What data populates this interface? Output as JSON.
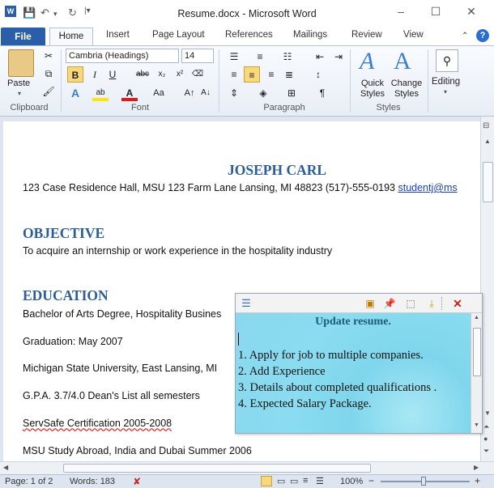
{
  "window": {
    "title": "Resume.docx - Microsoft Word"
  },
  "tabs": [
    "File",
    "Home",
    "Insert",
    "Page Layout",
    "References",
    "Mailings",
    "Review",
    "View"
  ],
  "ribbon": {
    "clipboard": {
      "paste_label": "Paste",
      "group_label": "Clipboard"
    },
    "font": {
      "font_name": "Cambria (Headings)",
      "font_size": "14",
      "group_label": "Font"
    },
    "paragraph": {
      "group_label": "Paragraph"
    },
    "styles": {
      "quick_styles": "Quick Styles",
      "change_styles": "Change Styles",
      "group_label": "Styles"
    },
    "editing": {
      "label": "Editing"
    }
  },
  "document": {
    "name": "JOSEPH CARL",
    "contact": "123  Case Residence Hall, MSU 123 Farm Lane Lansing, MI 48823  (517)-555-0193  ",
    "email": "studentj@ms",
    "objective_heading": "OBJECTIVE",
    "objective_text": "To acquire an internship or work experience in the hospitality industry",
    "education_heading": "EDUCATION",
    "edu_lines": [
      "Bachelor of Arts Degree, Hospitality Busines",
      " Graduation: May 2007",
      "Michigan State University, East Lansing, MI",
      "G.P.A. 3.7/4.0 Dean's List all semesters",
      "ServSafe Certification 2005-2008",
      "MSU Study Abroad, India and Dubai Summer 2006"
    ]
  },
  "note": {
    "title": "Update resume.",
    "items": [
      "1. Apply for job to multiple companies.",
      "2. Add Experience",
      "3. Details about completed qualifications .",
      "4. Expected Salary Package."
    ]
  },
  "status": {
    "page": "Page: 1 of 2",
    "words": "Words: 183",
    "zoom": "100%"
  },
  "colors": {
    "heading": "#2c5d99",
    "file_tab": "#2a5ea8",
    "note_bg": "#8ad8ee",
    "link": "#1a3fb8"
  }
}
